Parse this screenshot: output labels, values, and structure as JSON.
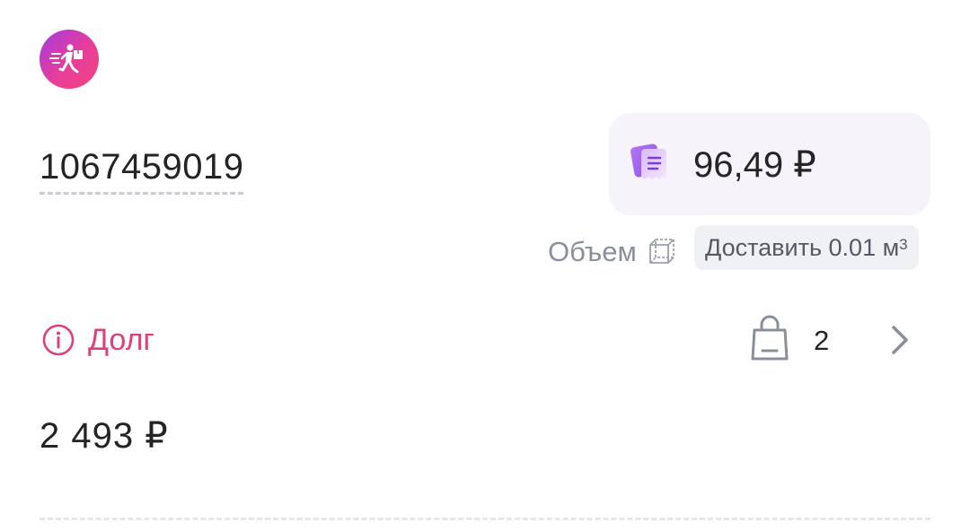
{
  "courier": {
    "avatar_icon": "courier-running-icon",
    "avatar_gradient": [
      "#a23ce0",
      "#f0457f"
    ]
  },
  "order": {
    "number": "1067459019"
  },
  "price": {
    "icon": "receipt-icon",
    "value": "96,49 ₽"
  },
  "volume": {
    "label": "Объем",
    "icon": "cube-icon",
    "deliver_text": "Доставить 0.01 м",
    "unit_superscript": "3"
  },
  "debt": {
    "icon": "info-icon",
    "label": "Долг",
    "amount": "2 493 ₽",
    "color": "#e03f7e"
  },
  "items": {
    "icon": "shopping-bag-icon",
    "count": "2",
    "chevron": "chevron-right-icon"
  }
}
